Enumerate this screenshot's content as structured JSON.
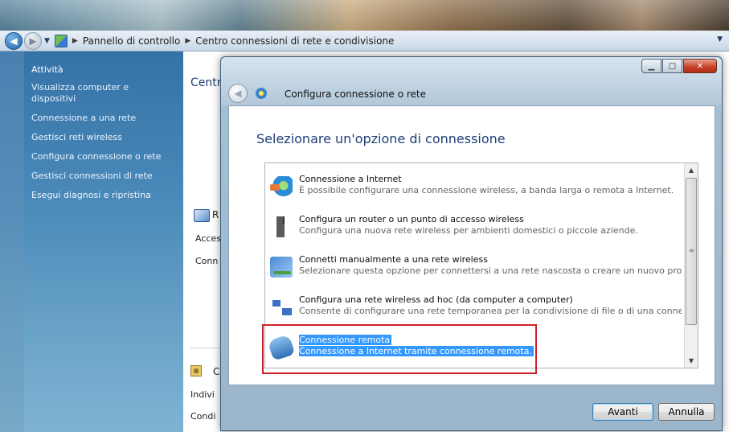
{
  "breadcrumb": {
    "item1": "Pannello di controllo",
    "item2": "Centro connessioni di rete e condivisione"
  },
  "sidebar": {
    "title": "Attività",
    "items": [
      "Visualizza computer e dispositivi",
      "Connessione a una rete",
      "Gestisci reti wireless",
      "Configura connessione o rete",
      "Gestisci connessioni di rete",
      "Esegui diagnosi e ripristina"
    ]
  },
  "main": {
    "heading": "Centr",
    "network_name": "R",
    "line_access": "Acces",
    "line_conn": "Conn",
    "section_title": "C",
    "line_indiv": "Indivi",
    "line_cond": "Condi"
  },
  "dialog": {
    "title": "Configura connessione o rete",
    "heading": "Selezionare un'opzione di connessione",
    "options": [
      {
        "title": "Connessione a Internet",
        "desc": "È possibile configurare una connessione wireless, a banda larga o remota a Internet.",
        "icon": "globe-icon"
      },
      {
        "title": "Configura un router o un punto di accesso wireless",
        "desc": "Configura una nuova rete wireless per ambienti domestici o piccole aziende.",
        "icon": "router-icon"
      },
      {
        "title": "Connetti manualmente a una rete wireless",
        "desc": "Selezionare questa opzione per connettersi a una rete nascosta o creare un nuovo profil...",
        "icon": "wireless-network-icon"
      },
      {
        "title": "Configura una rete wireless ad hoc (da computer a computer)",
        "desc": "Consente di configurare una rete temporanea per la condivisione di file o di una connes...",
        "icon": "adhoc-network-icon"
      },
      {
        "title": "Connessione remota",
        "desc": "Connessione a Internet tramite connessione remota.",
        "icon": "dialup-phone-icon",
        "selected": true
      }
    ],
    "buttons": {
      "next": "Avanti",
      "cancel": "Annulla"
    }
  },
  "colors": {
    "selection": "#3399ff",
    "highlight_border": "#d0202a",
    "heading": "#1e3e78"
  }
}
